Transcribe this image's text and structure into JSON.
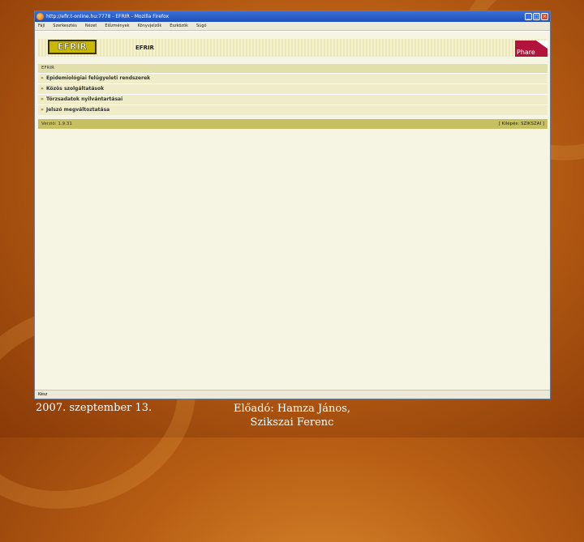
{
  "window": {
    "title": "http://efir.t-online.hu:7778 - EFRIR - Mozilla Firefox",
    "controls": {
      "minimize": "_",
      "maximize": "□",
      "close": "×"
    }
  },
  "menu": [
    "Fájl",
    "Szerkesztés",
    "Nézet",
    "Előzmények",
    "Könyvjelzők",
    "Eszközök",
    "Súgó"
  ],
  "page": {
    "logo_text": "EFRIR",
    "header_title": "EFRIR",
    "partner_logo": "Phare",
    "nav_header": "EFRIR",
    "nav_items": [
      "Epidemiológiai felügyeleti rendszerek",
      "Közös szolgáltatások",
      "Törzsadatok nyilvántartásai",
      "Jelszó megváltoztatása"
    ],
    "version": "Verzió: 1.9.31",
    "logout": "[ Kilépés: SZIKSZAI ]"
  },
  "status": "Kész",
  "slide": {
    "date": "2007. szeptember 13.",
    "presenter": "Előadó: Hamza János, Szikszai Ferenc"
  },
  "colors": {
    "accent": "#c8b900",
    "nav_bar": "#c7c062",
    "phare": "#b2133a"
  }
}
